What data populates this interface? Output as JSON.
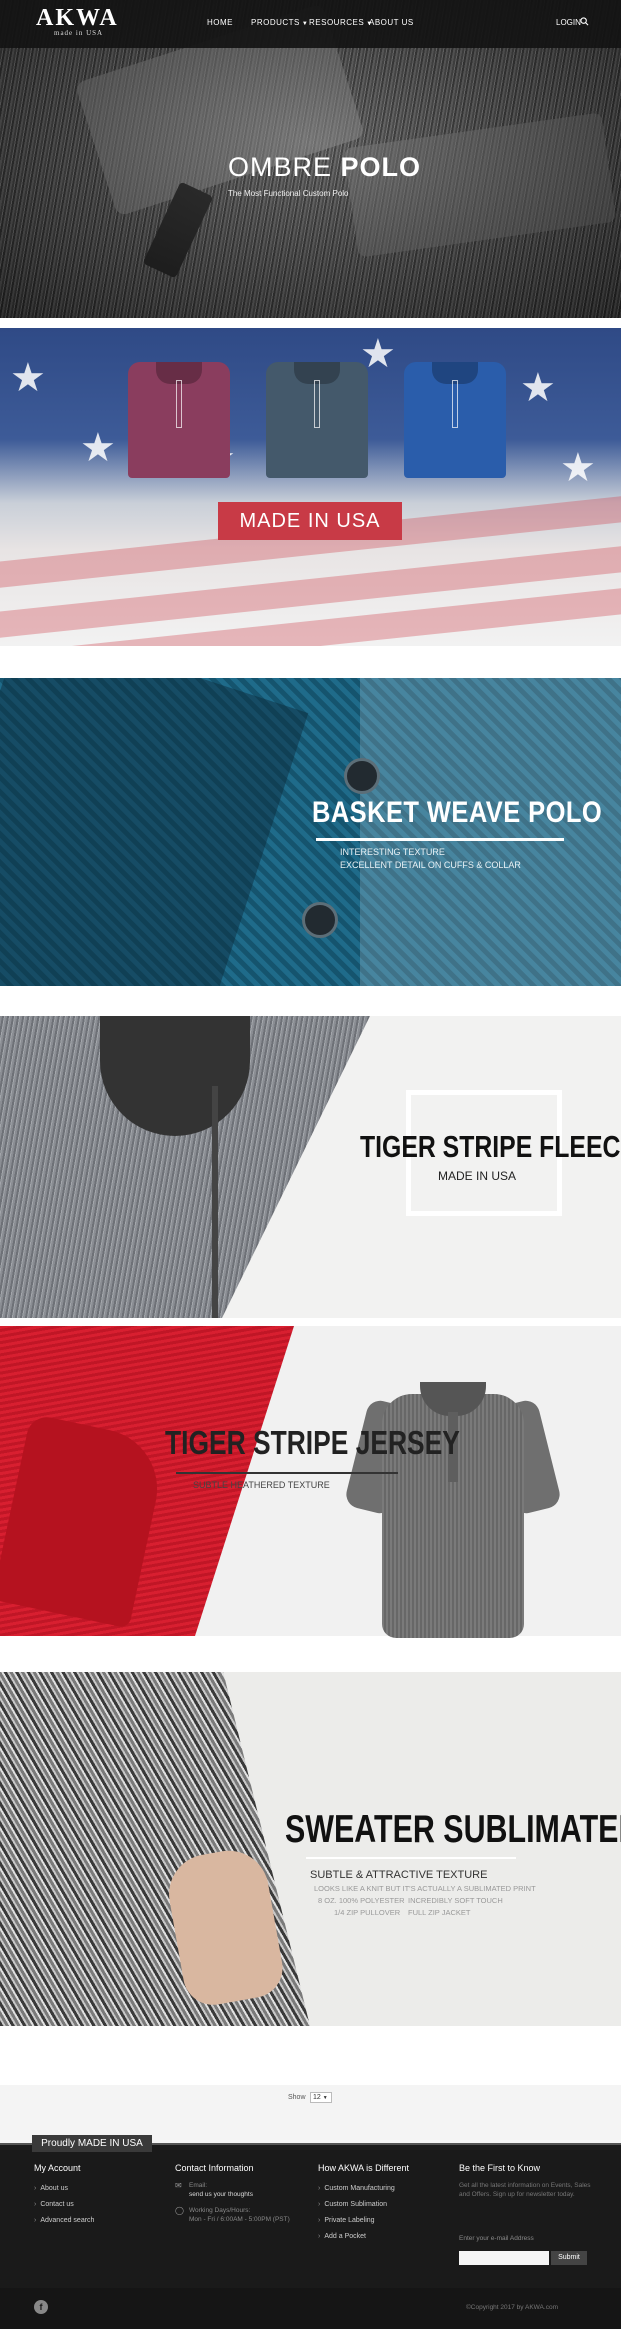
{
  "header": {
    "logo": "AKWA",
    "logo_sub": "made in USA",
    "nav": [
      "HOME",
      "PRODUCTS",
      "RESOURCES",
      "ABOUT US"
    ],
    "login": "LOGIN"
  },
  "hero_ombre": {
    "title_a": "OMBRE ",
    "title_b": "POLO",
    "subtitle": "The Most Functional Custom Polo"
  },
  "hero_usa": {
    "badge": "MADE IN USA"
  },
  "hero_basket": {
    "title": "BASKET WEAVE POLO",
    "line1": "INTERESTING TEXTURE",
    "line2": "EXCELLENT DETAIL ON CUFFS & COLLAR"
  },
  "hero_fleece": {
    "title": "TIGER STRIPE FLEECE",
    "subtitle": "MADE IN USA"
  },
  "hero_jersey": {
    "title": "TIGER STRIPE JERSEY",
    "subtitle": "SUBTLE HEATHERED TEXTURE"
  },
  "hero_sweater": {
    "title": "SWEATER SUBLIMATED",
    "subtitle": "SUBTLE & ATTRACTIVE TEXTURE",
    "line1": "LOOKS LIKE A KNIT BUT IT'S ACTUALLY A SUBLIMATED PRINT",
    "f1": "8 OZ. 100% POLYESTER",
    "f2": "INCREDIBLY SOFT TOUCH",
    "f3": "1/4 ZIP PULLOVER",
    "f4": "FULL ZIP JACKET"
  },
  "pager": {
    "show_label": "Show",
    "show_value": "12"
  },
  "footer": {
    "tag": "Proudly MADE IN USA",
    "col1": {
      "heading": "My Account",
      "links": [
        "About us",
        "Contact us",
        "Advanced search"
      ]
    },
    "col2": {
      "heading": "Contact Information",
      "email_label": "Email:",
      "email_value": "send us your thoughts",
      "hours_label": "Working Days/Hours:",
      "hours_value": "Mon - Fri / 6:00AM - 5:00PM (PST)"
    },
    "col3": {
      "heading": "How AKWA is Different",
      "links": [
        "Custom Manufacturing",
        "Custom Sublimation",
        "Private Labeling",
        "Add a Pocket"
      ]
    },
    "col4": {
      "heading": "Be the First to Know",
      "text": "Get all the latest information on Events, Sales and Offers. Sign up for newsletter today.",
      "email_label": "Enter your e-mail Address",
      "submit": "Submit"
    },
    "facebook": "f",
    "copyright": "©Copyright 2017 by AKWA.com"
  }
}
